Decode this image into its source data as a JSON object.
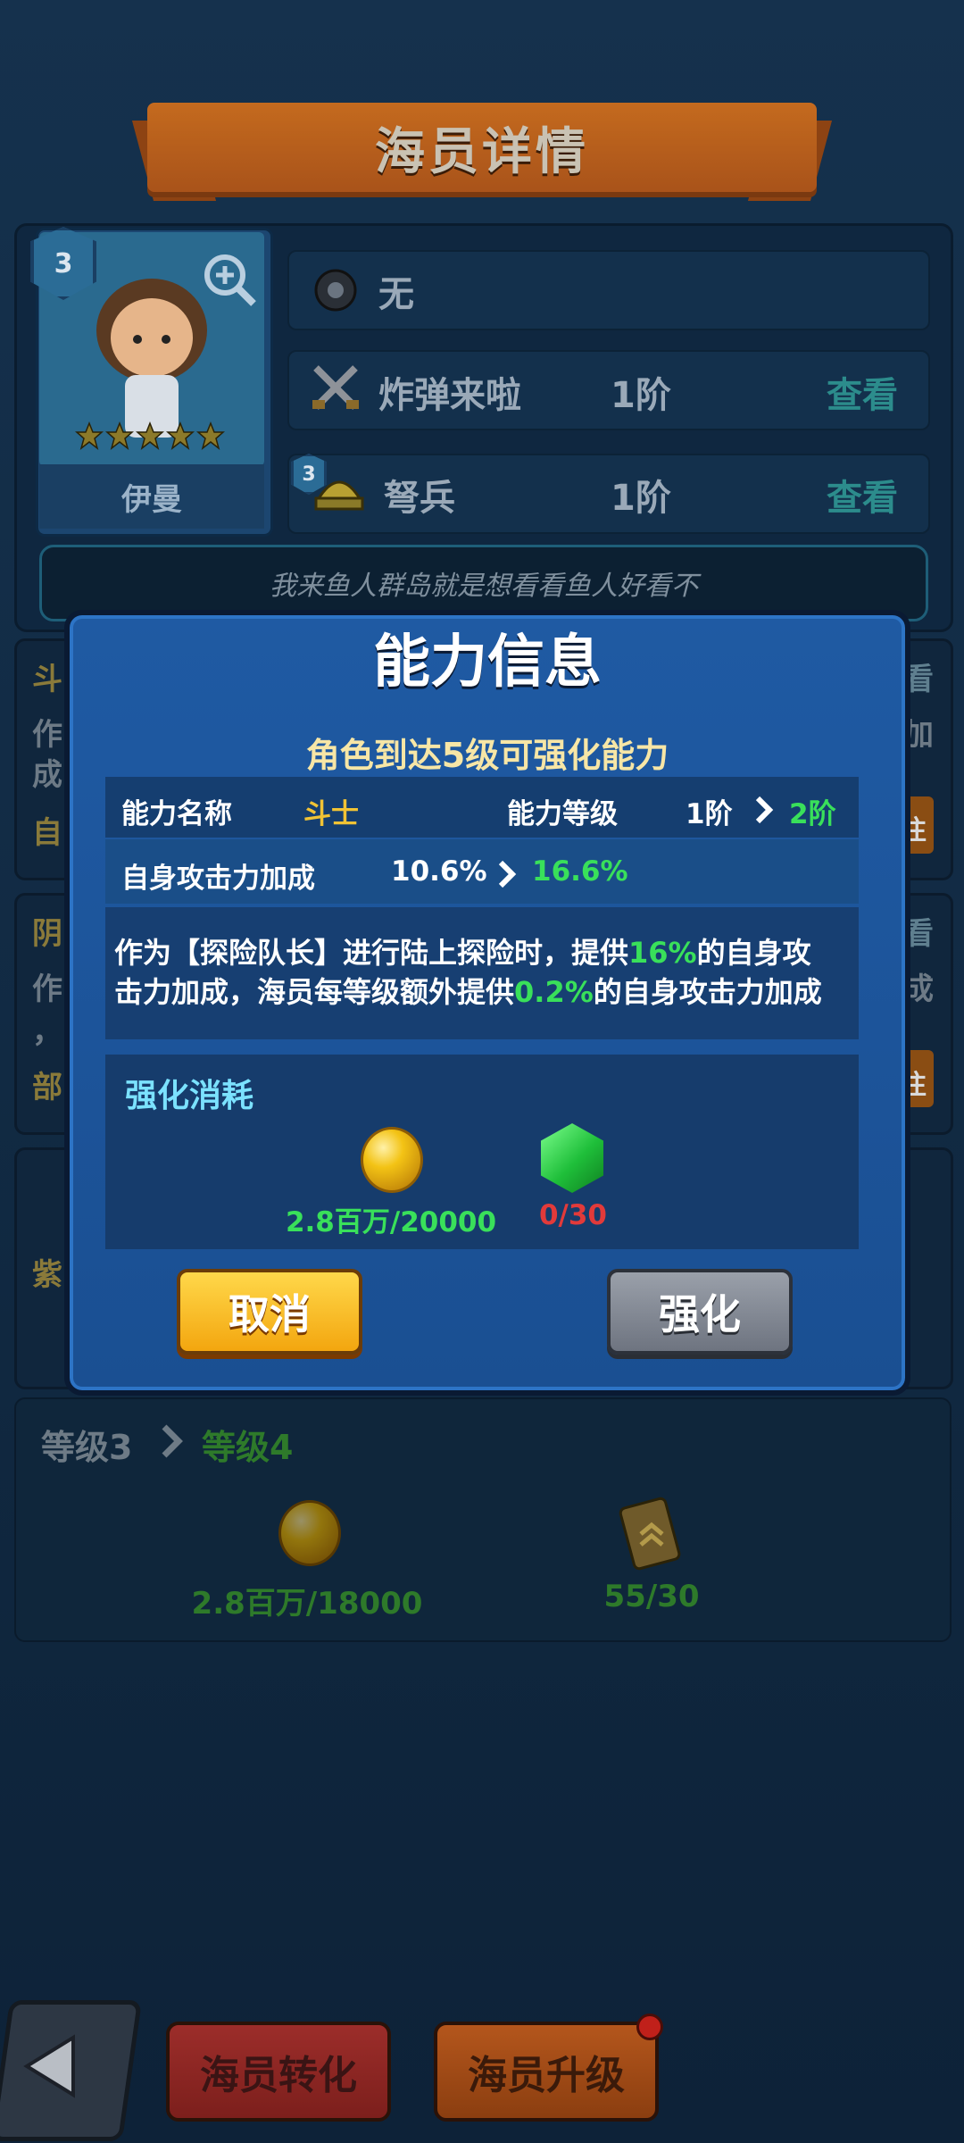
{
  "header": {
    "title": "海员详情"
  },
  "crew": {
    "level_badge": "3",
    "name": "伊曼",
    "stars": 5,
    "weapon": "无",
    "skill1": {
      "name": "炸弹来啦",
      "rank": "1阶",
      "view": "查看"
    },
    "skill2": {
      "badge": "3",
      "name": "弩兵",
      "rank": "1阶",
      "view": "查看"
    },
    "motto": "我来鱼人群岛就是想看看鱼人好看不"
  },
  "background_partial": {
    "left_chars": [
      "斗",
      "作",
      "成",
      "自",
      "阴",
      "作",
      "，",
      "部",
      "紫"
    ],
    "right_chars": [
      "看",
      "加",
      "往",
      "看",
      "成",
      "往"
    ]
  },
  "modal": {
    "title": "能力信息",
    "subtitle": "角色到达5级可强化能力",
    "ability_name_label": "能力名称",
    "ability_name_value": "斗士",
    "ability_level_label": "能力等级",
    "level_from": "1阶",
    "level_to": "2阶",
    "bonus_label": "自身攻击力加成",
    "bonus_from": "10.6%",
    "bonus_to": "16.6%",
    "desc_part1": "作为【探险队长】进行陆上探险时，提供",
    "desc_highlight1": "16%",
    "desc_part2": "的自身攻",
    "desc_line2_part1": "击力加成，海员每等级额外提供",
    "desc_highlight2": "0.2%",
    "desc_line2_part2": "的自身攻击力加成",
    "cost_title": "强化消耗",
    "cost_gold": "2.8百万/20000",
    "cost_gem": "0/30",
    "cancel": "取消",
    "enhance": "强化"
  },
  "level_up": {
    "from": "等级3",
    "to": "等级4",
    "gold": "2.8百万/18000",
    "books": "55/30"
  },
  "bottom": {
    "convert": "海员转化",
    "upgrade": "海员升级"
  }
}
